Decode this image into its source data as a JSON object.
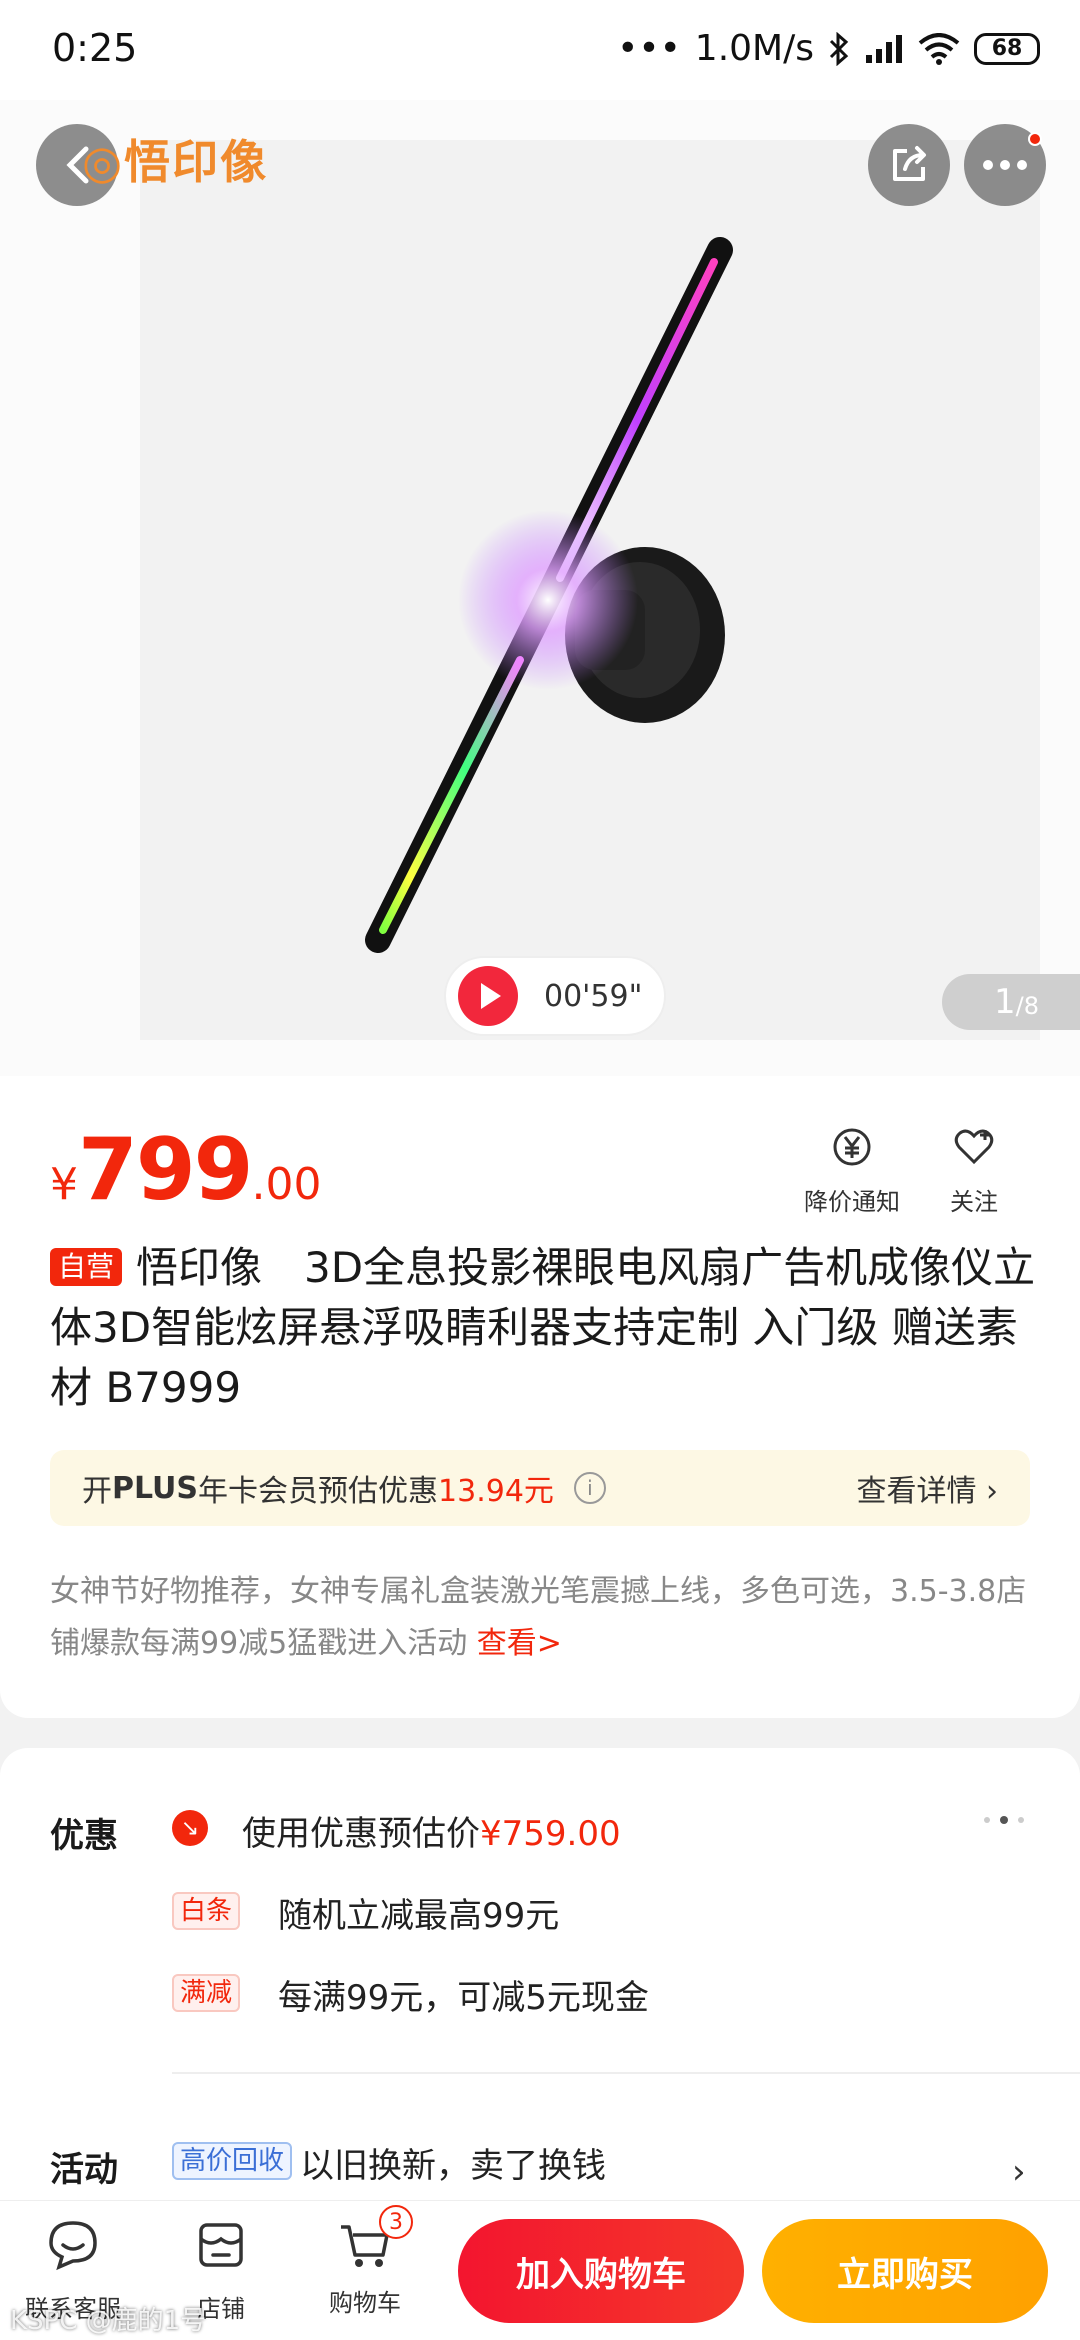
{
  "status_bar": {
    "time": "0:25",
    "speed": "1.0M/s",
    "battery": "68"
  },
  "header": {
    "shop_logo_text": "悟印像"
  },
  "gallery": {
    "video_duration": "00'59\"",
    "current_index": "1",
    "total": "/8"
  },
  "product": {
    "price_symbol": "¥",
    "price_integer": "799",
    "price_decimal": ".00",
    "price_alert_label": "降价通知",
    "follow_label": "关注",
    "self_operated_badge": "自营",
    "title": "悟印像　3D全息投影裸眼电风扇广告机成像仪立体3D智能炫屏悬浮吸睛利器支持定制  入门级 赠送素材  B7999",
    "plus_prefix": "开",
    "plus_bold": "PLUS",
    "plus_text": "年卡会员预估优惠",
    "plus_amount": "13.94元",
    "plus_info_icon": "i",
    "plus_detail": "查看详情 ›",
    "promo_text": "女神节好物推荐，女神专属礼盒装激光笔震撼上线，多色可选，3.5-3.8店铺爆款每满99减5猛戳进入活动 ",
    "promo_link": "查看>"
  },
  "offers": {
    "label": "优惠",
    "coupon_prefix": "使用优惠预估价",
    "coupon_price": "¥759.00",
    "baitiao_tag": "白条",
    "baitiao_text": "随机立减最高99元",
    "manjian_tag": "满减",
    "manjian_text": "每满99元，可减5元现金",
    "activity_label": "活动",
    "activity_tag": "高价回收",
    "activity_text": "以旧换新，卖了换钱"
  },
  "bottom_bar": {
    "service_label": "联系客服",
    "shop_label": "店铺",
    "cart_label": "购物车",
    "cart_count": "3",
    "add_to_cart": "加入购物车",
    "buy_now": "立即购买"
  },
  "watermark": "KSPC @鹿的1号",
  "colors": {
    "accent_red": "#f2270c",
    "buy_orange": "#ffa100",
    "plus_bg": "#fdf8e4"
  }
}
